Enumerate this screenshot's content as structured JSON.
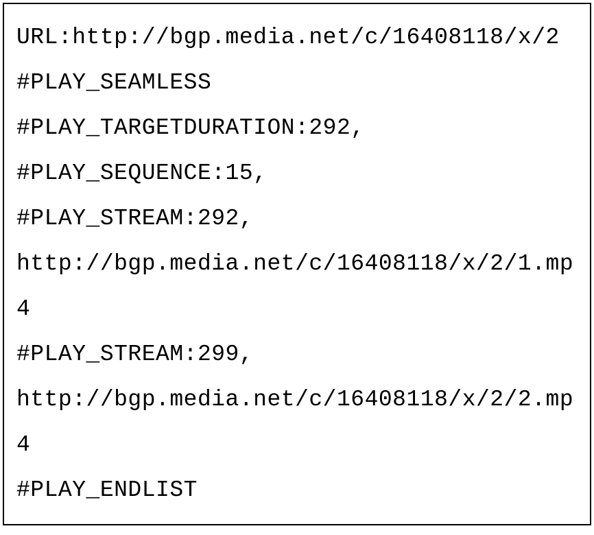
{
  "lines": {
    "l0": "URL:http://bgp.media.net/c/16408118/x/2",
    "l1": "#PLAY_SEAMLESS",
    "l2": "#PLAY_TARGETDURATION:292,",
    "l3": "#PLAY_SEQUENCE:15,",
    "l4": "#PLAY_STREAM:292,",
    "l5": "http://bgp.media.net/c/16408118/x/2/1.mp4",
    "l6": "#PLAY_STREAM:299,",
    "l7": "http://bgp.media.net/c/16408118/x/2/2.mp4",
    "l8": "#PLAY_ENDLIST"
  }
}
